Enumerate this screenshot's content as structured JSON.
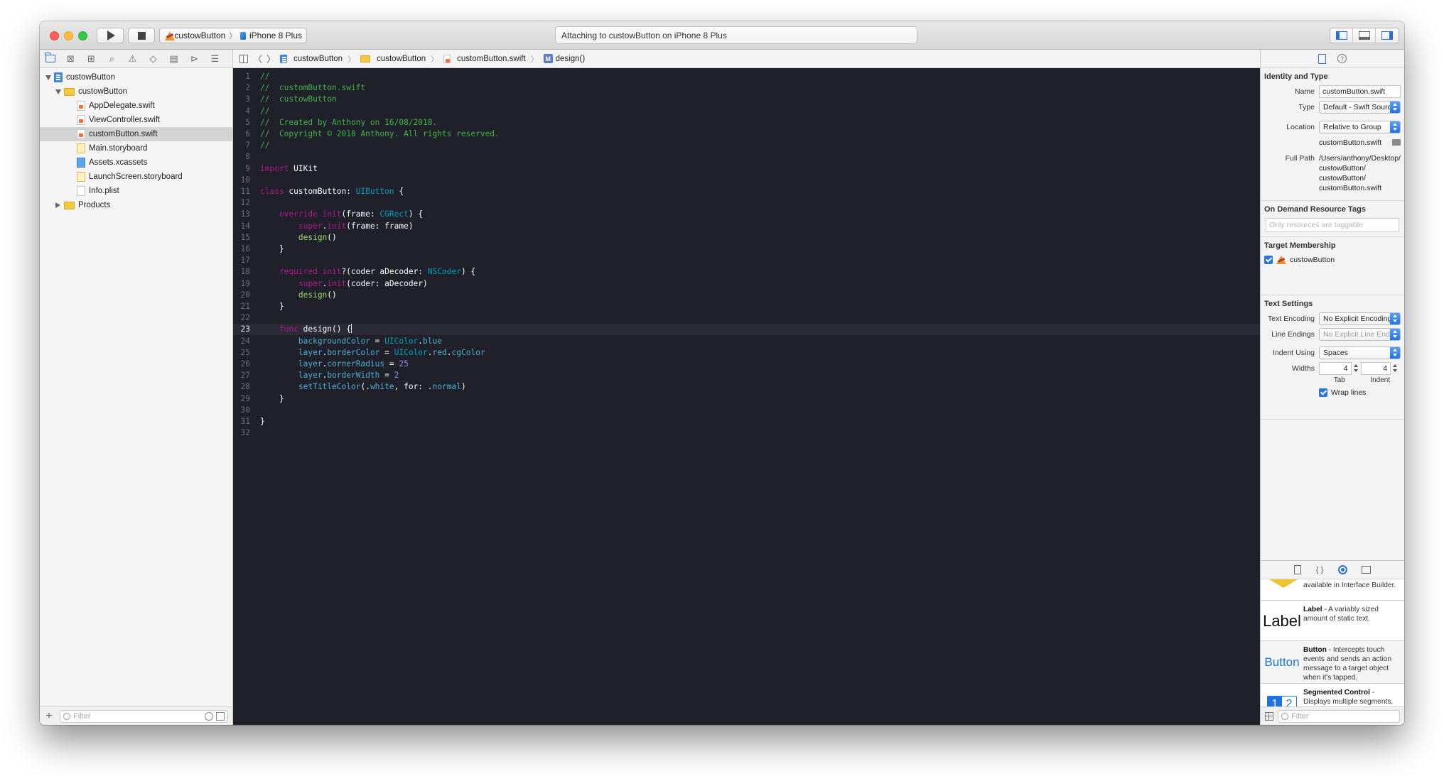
{
  "toolbar": {
    "scheme": "custowButton",
    "device": "iPhone 8 Plus",
    "activity": "Attaching to custowButton on iPhone 8 Plus"
  },
  "navigator": {
    "tree": [
      {
        "label": "custowButton",
        "kind": "project",
        "level": 0,
        "disclosure": "open"
      },
      {
        "label": "custowButton",
        "kind": "folder",
        "level": 1,
        "disclosure": "open"
      },
      {
        "label": "AppDelegate.swift",
        "kind": "swift",
        "level": 2,
        "disclosure": "none"
      },
      {
        "label": "ViewController.swift",
        "kind": "swift",
        "level": 2,
        "disclosure": "none"
      },
      {
        "label": "customButton.swift",
        "kind": "swift",
        "level": 2,
        "disclosure": "none",
        "selected": true
      },
      {
        "label": "Main.storyboard",
        "kind": "storyboard",
        "level": 2,
        "disclosure": "none"
      },
      {
        "label": "Assets.xcassets",
        "kind": "assets",
        "level": 2,
        "disclosure": "none"
      },
      {
        "label": "LaunchScreen.storyboard",
        "kind": "storyboard",
        "level": 2,
        "disclosure": "none"
      },
      {
        "label": "Info.plist",
        "kind": "plist",
        "level": 2,
        "disclosure": "none"
      },
      {
        "label": "Products",
        "kind": "folder",
        "level": 1,
        "disclosure": "closed"
      }
    ],
    "filter_placeholder": "Filter"
  },
  "jumpbar": {
    "crumbs": [
      "custowButton",
      "custowButton",
      "customButton.swift",
      "design()"
    ],
    "method_badge": "M"
  },
  "editor": {
    "current_line": 23,
    "lines": [
      [
        [
          "//",
          "comment"
        ]
      ],
      [
        [
          "//  customButton.swift",
          "comment"
        ]
      ],
      [
        [
          "//  custowButton",
          "comment"
        ]
      ],
      [
        [
          "//",
          "comment"
        ]
      ],
      [
        [
          "//  Created by Anthony on 16/08/2018.",
          "comment"
        ]
      ],
      [
        [
          "//  Copyright © 2018 Anthony. All rights reserved.",
          "comment"
        ]
      ],
      [
        [
          "//",
          "comment"
        ]
      ],
      [],
      [
        [
          "import",
          "keyword"
        ],
        [
          " UIKit",
          "plain"
        ]
      ],
      [],
      [
        [
          "class",
          "keyword"
        ],
        [
          " customButton: ",
          "plain"
        ],
        [
          "UIButton",
          "type"
        ],
        [
          " {",
          "plain"
        ]
      ],
      [],
      [
        [
          "    override",
          "keyword"
        ],
        [
          " ",
          "plain"
        ],
        [
          "init",
          "keyword"
        ],
        [
          "(frame: ",
          "plain"
        ],
        [
          "CGRect",
          "type"
        ],
        [
          ") {",
          "plain"
        ]
      ],
      [
        [
          "        super",
          "keyword"
        ],
        [
          ".",
          "plain"
        ],
        [
          "init",
          "keyword"
        ],
        [
          "(frame: frame)",
          "plain"
        ]
      ],
      [
        [
          "        design",
          "func"
        ],
        [
          "()",
          "plain"
        ]
      ],
      [
        [
          "    }",
          "plain"
        ]
      ],
      [],
      [
        [
          "    required",
          "keyword"
        ],
        [
          " ",
          "plain"
        ],
        [
          "init",
          "keyword"
        ],
        [
          "?(coder aDecoder: ",
          "plain"
        ],
        [
          "NSCoder",
          "type"
        ],
        [
          ") {",
          "plain"
        ]
      ],
      [
        [
          "        super",
          "keyword"
        ],
        [
          ".",
          "plain"
        ],
        [
          "init",
          "keyword"
        ],
        [
          "(coder: aDecoder)",
          "plain"
        ]
      ],
      [
        [
          "        design",
          "func"
        ],
        [
          "()",
          "plain"
        ]
      ],
      [
        [
          "    }",
          "plain"
        ]
      ],
      [],
      [
        [
          "    func",
          "keyword"
        ],
        [
          " design() {",
          "plain"
        ],
        [
          "|",
          "caret"
        ]
      ],
      [
        [
          "        backgroundColor",
          "prop"
        ],
        [
          " = ",
          "plain"
        ],
        [
          "UIColor",
          "type"
        ],
        [
          ".",
          "plain"
        ],
        [
          "blue",
          "prop"
        ]
      ],
      [
        [
          "        layer",
          "prop"
        ],
        [
          ".",
          "plain"
        ],
        [
          "borderColor",
          "prop"
        ],
        [
          " = ",
          "plain"
        ],
        [
          "UIColor",
          "type"
        ],
        [
          ".",
          "plain"
        ],
        [
          "red",
          "prop"
        ],
        [
          ".",
          "plain"
        ],
        [
          "cgColor",
          "prop"
        ]
      ],
      [
        [
          "        layer",
          "prop"
        ],
        [
          ".",
          "plain"
        ],
        [
          "cornerRadius",
          "prop"
        ],
        [
          " = ",
          "plain"
        ],
        [
          "25",
          "num"
        ]
      ],
      [
        [
          "        layer",
          "prop"
        ],
        [
          ".",
          "plain"
        ],
        [
          "borderWidth",
          "prop"
        ],
        [
          " = ",
          "plain"
        ],
        [
          "2",
          "num"
        ]
      ],
      [
        [
          "        setTitleColor",
          "prop"
        ],
        [
          "(.",
          "plain"
        ],
        [
          "white",
          "prop"
        ],
        [
          ", for: .",
          "plain"
        ],
        [
          "normal",
          "prop"
        ],
        [
          ")",
          "plain"
        ]
      ],
      [
        [
          "    }",
          "plain"
        ]
      ],
      [],
      [
        [
          "}",
          "plain"
        ]
      ],
      []
    ]
  },
  "inspector": {
    "identity_title": "Identity and Type",
    "name_label": "Name",
    "name_value": "customButton.swift",
    "type_label": "Type",
    "type_value": "Default - Swift Source",
    "location_label": "Location",
    "location_value": "Relative to Group",
    "location_file": "customButton.swift",
    "fullpath_label": "Full Path",
    "fullpath_value": "/Users/anthony/Desktop/ custowButton/ custowButton/ customButton.swift",
    "tags_title": "On Demand Resource Tags",
    "tags_placeholder": "Only resources are taggable",
    "target_title": "Target Membership",
    "target_name": "custowButton",
    "text_title": "Text Settings",
    "encoding_label": "Text Encoding",
    "encoding_value": "No Explicit Encoding",
    "endings_label": "Line Endings",
    "endings_value": "No Explicit Line Endings",
    "indent_label": "Indent Using",
    "indent_value": "Spaces",
    "widths_label": "Widths",
    "tab_width": "4",
    "indent_width": "4",
    "tab_caption": "Tab",
    "indent_caption": "Indent",
    "wrap_label": "Wrap lines"
  },
  "library": {
    "partial_text": "available in Interface Builder.",
    "items": [
      {
        "thumb": "Label",
        "name": "Label",
        "desc": " - A variably sized amount of static text."
      },
      {
        "thumb": "Button",
        "name": "Button",
        "desc": " - Intercepts touch events and sends an action message to a target object when it's tapped."
      },
      {
        "thumb_seg": [
          "1",
          "2"
        ],
        "name": "Segmented Control",
        "desc": " - Displays multiple segments, each of which functions as a discrete button."
      }
    ],
    "filter_placeholder": "Filter"
  },
  "colors": {
    "editor_bg": "#1f2029",
    "comment": "#41b645",
    "keyword": "#b21889",
    "type": "#00a0be",
    "accent": "#2a71d8"
  }
}
